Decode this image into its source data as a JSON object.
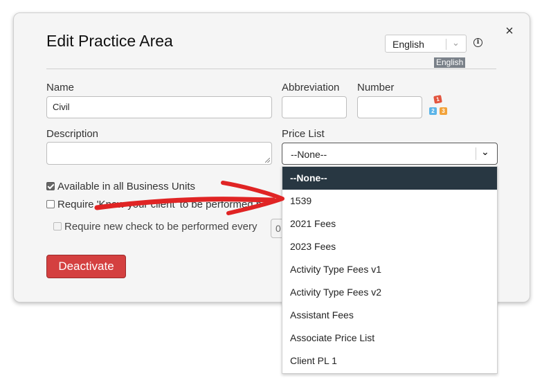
{
  "dialog": {
    "title": "Edit Practice Area",
    "close_label": "×",
    "language": {
      "selected": "English",
      "tag": "English"
    }
  },
  "form": {
    "name": {
      "label": "Name",
      "value": "Civil"
    },
    "abbreviation": {
      "label": "Abbreviation",
      "value": ""
    },
    "number": {
      "label": "Number",
      "value": ""
    },
    "description": {
      "label": "Description",
      "value": ""
    },
    "price_list": {
      "label": "Price List",
      "selected": "--None--"
    },
    "checkbox_available": {
      "label": "Available in all Business Units",
      "checked": true
    },
    "checkbox_kyc": {
      "label": "Require 'Know your client' to be performed b",
      "checked": false
    },
    "checkbox_recheck": {
      "label": "Require new check to be performed every",
      "checked": false,
      "value": "0"
    }
  },
  "buttons": {
    "deactivate": "Deactivate"
  },
  "price_list_dropdown": {
    "options": [
      "--None--",
      "1539",
      "2021 Fees",
      "2023 Fees",
      "Activity Type Fees v1",
      "Activity Type Fees v2",
      "Assistant Fees",
      "Associate Price List",
      "Client PL 1"
    ]
  },
  "colors": {
    "danger": "#d44040",
    "dropdown_selected": "#283742",
    "annotation_arrow": "#e02424"
  },
  "icons": {
    "close": "close-icon",
    "info": "info-icon",
    "chevron": "chevron-down-icon",
    "number_generator": "number-blocks-icon"
  }
}
